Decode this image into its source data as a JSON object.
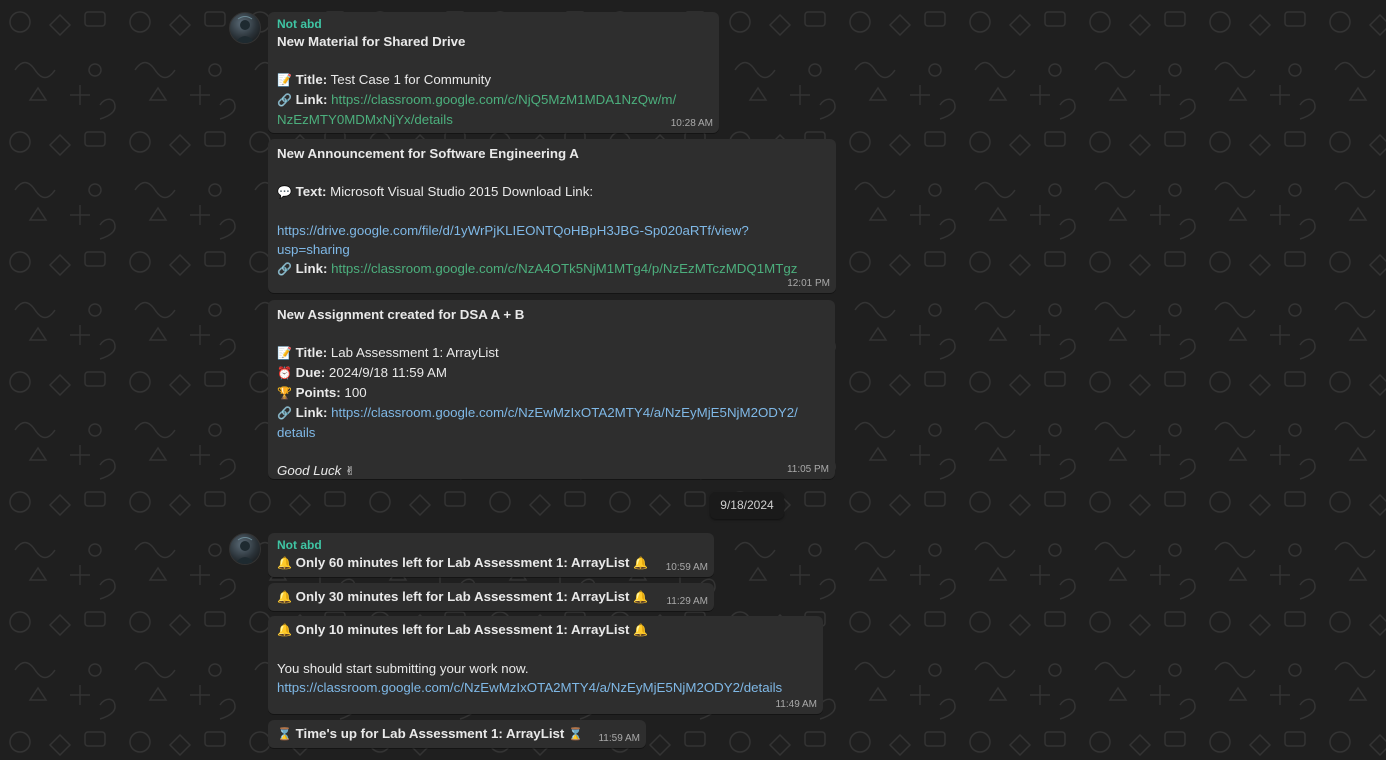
{
  "chat": {
    "date_separator": "9/18/2024",
    "msg1": {
      "sender": "Not abd",
      "title": "New Material for Shared Drive",
      "title_label": "Title:",
      "title_value": "Test Case 1 for Community",
      "link_label": "Link:",
      "link_line1": "https://classroom.google.com/c/NjQ5MzM1MDA1NzQw/m/",
      "link_line2": "NzEzMTY0MDMxNjYx/details",
      "time": "10:28 AM",
      "icon_title": "📝",
      "icon_link": "🔗"
    },
    "msg2": {
      "title": "New Announcement for Software Engineering A",
      "text_label": "Text:",
      "text_value": "Microsoft Visual Studio 2015 Download Link:",
      "drive_line1": "https://drive.google.com/file/d/1yWrPjKLIEONTQoHBpH3JBG-Sp020aRTf/view?",
      "drive_line2": "usp=sharing",
      "link_label": "Link:",
      "link": "https://classroom.google.com/c/NzA4OTk5NjM1MTg4/p/NzEzMTczMDQ1MTgz",
      "time": "12:01 PM",
      "icon_text": "💬",
      "icon_link": "🔗"
    },
    "msg3": {
      "title": "New Assignment created for DSA A + B",
      "title_label": "Title:",
      "title_value": "Lab Assessment 1: ArrayList",
      "due_label": "Due:",
      "due_value": "2024/9/18 11:59 AM",
      "points_label": "Points:",
      "points_value": "100",
      "link_label": "Link:",
      "link_line1": "https://classroom.google.com/c/NzEwMzIxOTA2MTY4/a/NzEyMjE5NjM2ODY2/",
      "link_line2": "details",
      "closing": "Good Luck",
      "time": "11:05 PM",
      "icon_title": "📝",
      "icon_due": "⏰",
      "icon_points": "🏆",
      "icon_link": "🔗",
      "icon_closing": "✌"
    },
    "msg4": {
      "sender": "Not abd",
      "text": "Only 60 minutes left for Lab Assessment 1: ArrayList",
      "time": "10:59 AM",
      "icon": "🔔"
    },
    "msg5": {
      "text": "Only 30 minutes left for Lab Assessment 1: ArrayList",
      "time": "11:29 AM",
      "icon": "🔔"
    },
    "msg6": {
      "text": "Only 10 minutes left for Lab Assessment 1: ArrayList",
      "body": "You should start submitting your work now.",
      "link": "https://classroom.google.com/c/NzEwMzIxOTA2MTY4/a/NzEyMjE5NjM2ODY2/details",
      "time": "11:49 AM",
      "icon": "🔔"
    },
    "msg7": {
      "text": "Time's up for Lab Assessment 1: ArrayList",
      "time": "11:59 AM",
      "icon": "⌛"
    }
  },
  "colors": {
    "background": "#1f1f1f",
    "bubble": "#2e2e2e",
    "sender": "#3fc5a4",
    "link_blue": "#7fb8e6",
    "link_green": "#4caf7d",
    "timestamp": "#a9a9a9"
  }
}
